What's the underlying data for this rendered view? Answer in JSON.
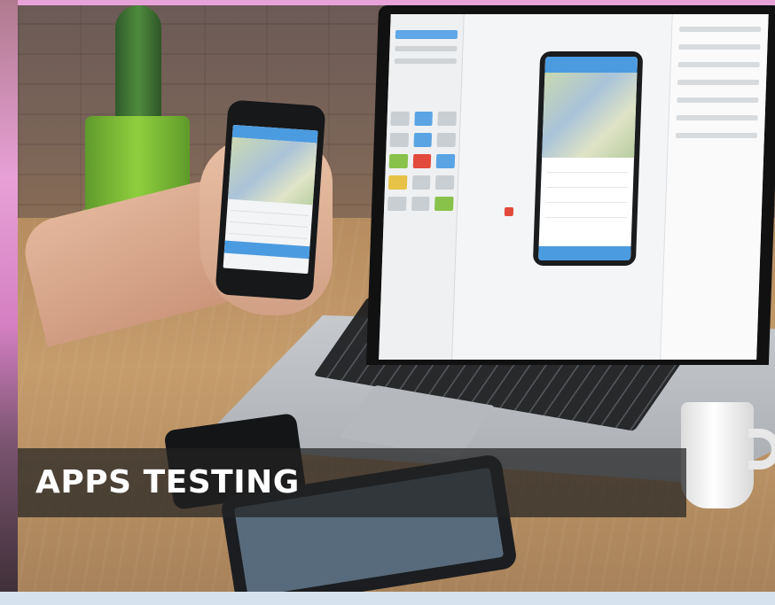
{
  "caption": {
    "title": "APPS TESTING"
  },
  "colors": {
    "pink_frame": "#e6a2d9",
    "app_accent_blue": "#4b9be0",
    "caption_band": "#232323",
    "caption_text": "#ffffff"
  },
  "scene": {
    "icons": [
      "plant",
      "laptop-icon",
      "smartphone-icon",
      "tablet-icon",
      "coffee-cup-icon"
    ]
  }
}
